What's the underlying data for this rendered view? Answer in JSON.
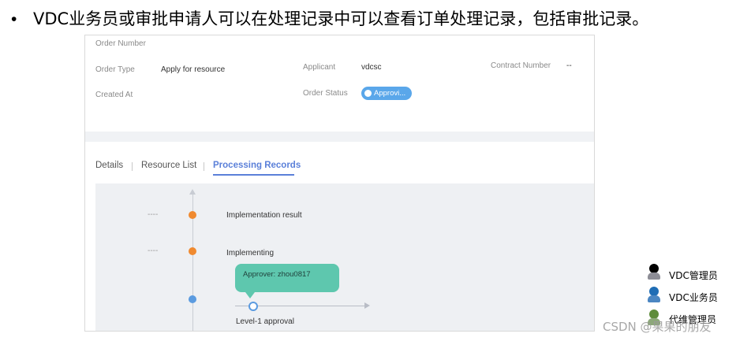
{
  "heading": {
    "bullet": "•",
    "text": "VDC业务员或审批申请人可以在处理记录中可以查看订单处理记录，包括审批记录。"
  },
  "order": {
    "order_number_label": "Order Number",
    "order_type_label": "Order Type",
    "order_type_value": "Apply for resource",
    "applicant_label": "Applicant",
    "applicant_value": "vdcsc",
    "contract_number_label": "Contract Number",
    "contract_number_value": "--",
    "created_at_label": "Created At",
    "order_status_label": "Order Status",
    "order_status_value": "Approvi..."
  },
  "tabs": [
    {
      "label": "Details"
    },
    {
      "label": "Resource List"
    },
    {
      "label": "Processing Records"
    }
  ],
  "records": [
    {
      "time": "----",
      "text": "Implementation result"
    },
    {
      "time": "----",
      "text": "Implementing"
    }
  ],
  "approval": {
    "bubble_text": "Approver: zhou0817",
    "level_label": "Level-1 approval"
  },
  "legend": [
    {
      "label": "VDC管理员",
      "color": "#000000"
    },
    {
      "label": "VDC业务员",
      "color": "#1f6db5"
    },
    {
      "label": "代维管理员",
      "color": "#5e8c3a"
    }
  ],
  "watermark": "CSDN @果果的朋友",
  "colors": {
    "accent": "#5b80d9",
    "orange_node": "#f08a2f",
    "blue_node": "#5b9be0",
    "bubble": "#5ec7ae",
    "status_pill": "#5aa7ea"
  }
}
